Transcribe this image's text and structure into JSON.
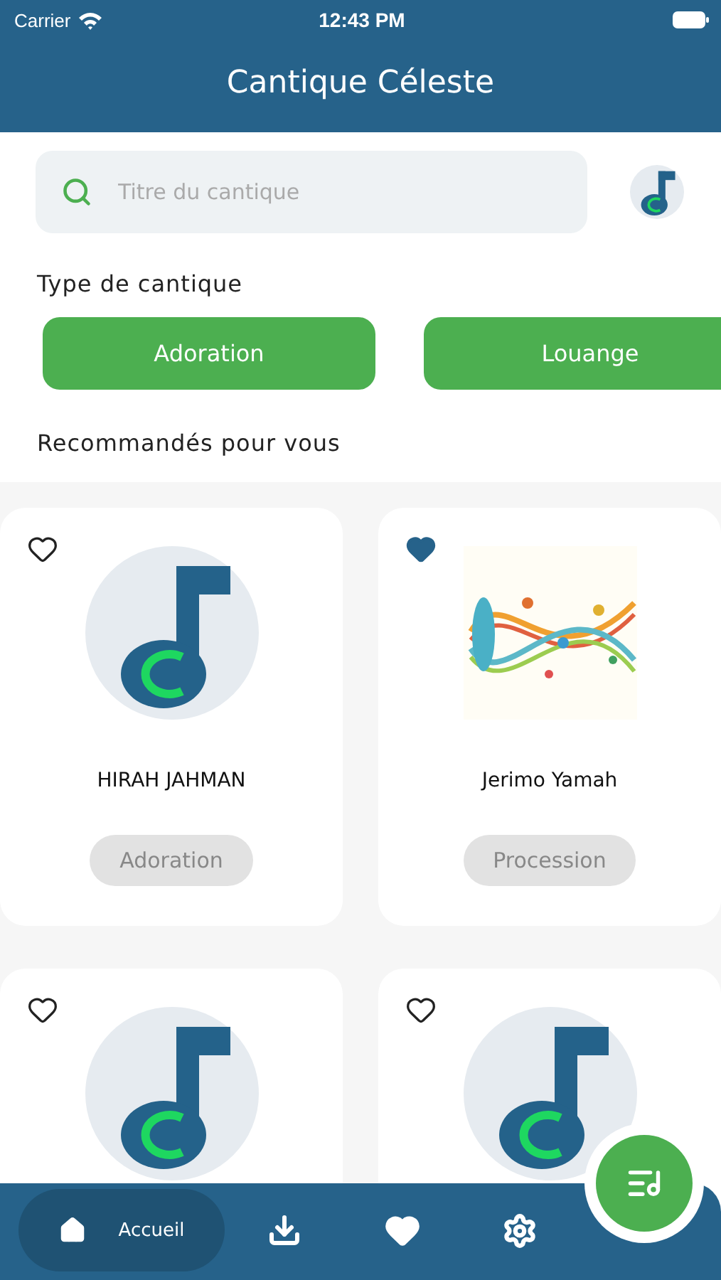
{
  "status_bar": {
    "carrier": "Carrier",
    "time": "12:43 PM"
  },
  "header": {
    "title": "Cantique Céleste"
  },
  "search": {
    "placeholder": "Titre du cantique"
  },
  "categories": {
    "title": "Type de cantique",
    "items": [
      {
        "label": "Adoration"
      },
      {
        "label": "Louange"
      }
    ]
  },
  "recommended": {
    "title": "Recommandés pour vous",
    "cards": [
      {
        "kind": "logo",
        "favorite": false,
        "title": "HIRAH JAHMAN",
        "tag": "Adoration"
      },
      {
        "kind": "picture",
        "favorite": true,
        "title": "Jerimo Yamah",
        "tag": "Procession"
      },
      {
        "kind": "logo",
        "favorite": false
      },
      {
        "kind": "logo",
        "favorite": false
      }
    ]
  },
  "nav": {
    "items": [
      {
        "kind": "home",
        "label": "Accueil",
        "selected": true
      },
      {
        "kind": "download",
        "selected": false
      },
      {
        "kind": "favorites",
        "selected": false
      },
      {
        "kind": "settings",
        "selected": false
      }
    ]
  }
}
